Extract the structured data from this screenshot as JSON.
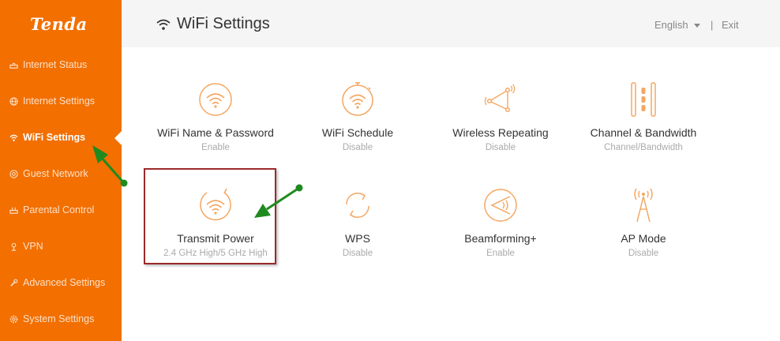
{
  "brand": {
    "logo_text": "Tenda",
    "accent": "#f26f00"
  },
  "sidebar": {
    "items": [
      {
        "label": "Internet Status",
        "icon": "router-icon",
        "active": false
      },
      {
        "label": "Internet Settings",
        "icon": "globe-icon",
        "active": false
      },
      {
        "label": "WiFi Settings",
        "icon": "wifi-icon",
        "active": true
      },
      {
        "label": "Guest Network",
        "icon": "guest-icon",
        "active": false
      },
      {
        "label": "Parental Control",
        "icon": "parental-icon",
        "active": false
      },
      {
        "label": "VPN",
        "icon": "vpn-icon",
        "active": false
      },
      {
        "label": "Advanced Settings",
        "icon": "wrench-icon",
        "active": false
      },
      {
        "label": "System Settings",
        "icon": "gear-icon",
        "active": false
      }
    ]
  },
  "header": {
    "title": "WiFi Settings",
    "language": "English",
    "separator": "|",
    "exit_label": "Exit"
  },
  "tiles": [
    {
      "title": "WiFi Name & Password",
      "status": "Enable",
      "icon": "wifi-circle-icon"
    },
    {
      "title": "WiFi Schedule",
      "status": "Disable",
      "icon": "wifi-timer-icon"
    },
    {
      "title": "Wireless Repeating",
      "status": "Disable",
      "icon": "repeater-icon"
    },
    {
      "title": "Channel & Bandwidth",
      "status": "Channel/Bandwidth",
      "icon": "channel-icon"
    },
    {
      "title": "Transmit Power",
      "status": "2.4 GHz High/5 GHz High",
      "icon": "transmit-power-icon"
    },
    {
      "title": "WPS",
      "status": "Disable",
      "icon": "wps-icon"
    },
    {
      "title": "Beamforming+",
      "status": "Enable",
      "icon": "beamforming-icon"
    },
    {
      "title": "AP Mode",
      "status": "Disable",
      "icon": "ap-tower-icon"
    }
  ],
  "colors": {
    "sidebar_bg": "#f26f00",
    "icon_orange": "#f4a763",
    "highlight_border": "#9b2a2a",
    "annotation_arrow": "#1f8a1f"
  }
}
